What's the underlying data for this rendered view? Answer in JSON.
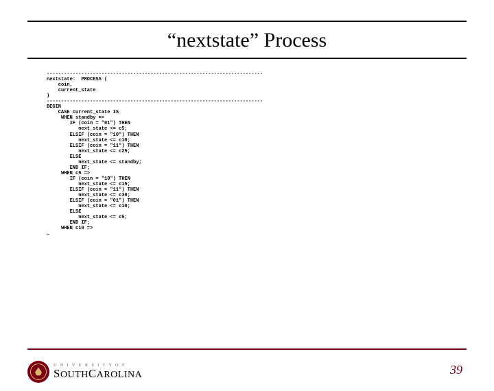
{
  "slide": {
    "title": "“nextstate” Process",
    "code": "---------------------------------------------------------------------------\nnextstate:  PROCESS (\n    coin,\n    current_state\n)\n---------------------------------------------------------------------------\nBEGIN\n    CASE current_state IS\n     WHEN standby =>\n        IF (coin = \"01\") THEN\n           next_state <= c5;\n        ELSIF (coin = \"10\") THEN\n           next_state <= c10;\n        ELSIF (coin = \"11\") THEN\n           next_state <= c25;\n        ELSE\n           next_state <= standby;\n        END IF;\n     WHEN c5 =>\n        IF (coin = \"10\") THEN\n           next_state <= c15;\n        ELSIF (coin = \"11\") THEN\n           next_state <= c30;\n        ELSIF (coin = \"01\") THEN\n           next_state <= c10;\n        ELSE\n           next_state <= c5;\n        END IF;\n     WHEN c10 =>\n…"
  },
  "footer": {
    "logo_line1": "U N I V E R S I T Y  O F",
    "logo_line2_a": "S",
    "logo_line2_b": "OUTH",
    "logo_line2_c": "C",
    "logo_line2_d": "AROLINA",
    "page_number": "39"
  }
}
